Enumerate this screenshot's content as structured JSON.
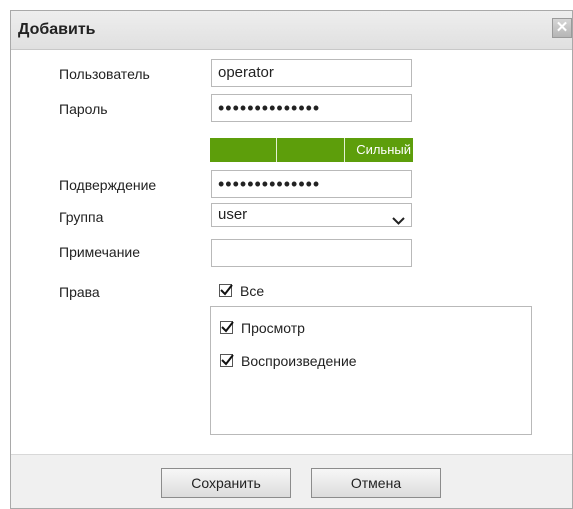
{
  "dialog": {
    "title": "Добавить",
    "close_label": "✕"
  },
  "form": {
    "username": {
      "label": "Пользователь",
      "value": "operator"
    },
    "password": {
      "label": "Пароль",
      "value": "••••••••••••••"
    },
    "strength": {
      "level": 3,
      "max": 3,
      "label": "Сильный",
      "color": "#5d9e0b"
    },
    "confirm": {
      "label": "Подверждение",
      "value": "••••••••••••••"
    },
    "group": {
      "label": "Группа",
      "value": "user"
    },
    "note": {
      "label": "Примечание",
      "value": ""
    },
    "rights": {
      "label": "Права",
      "all": {
        "label": "Все",
        "checked": true
      },
      "items": [
        {
          "label": "Просмотр",
          "checked": true
        },
        {
          "label": "Воспроизведение",
          "checked": true
        }
      ]
    }
  },
  "footer": {
    "save_label": "Сохранить",
    "cancel_label": "Отмена"
  },
  "icons": {
    "close": "close-icon",
    "dropdown": "chevron-down-icon",
    "check": "checkmark-icon"
  }
}
